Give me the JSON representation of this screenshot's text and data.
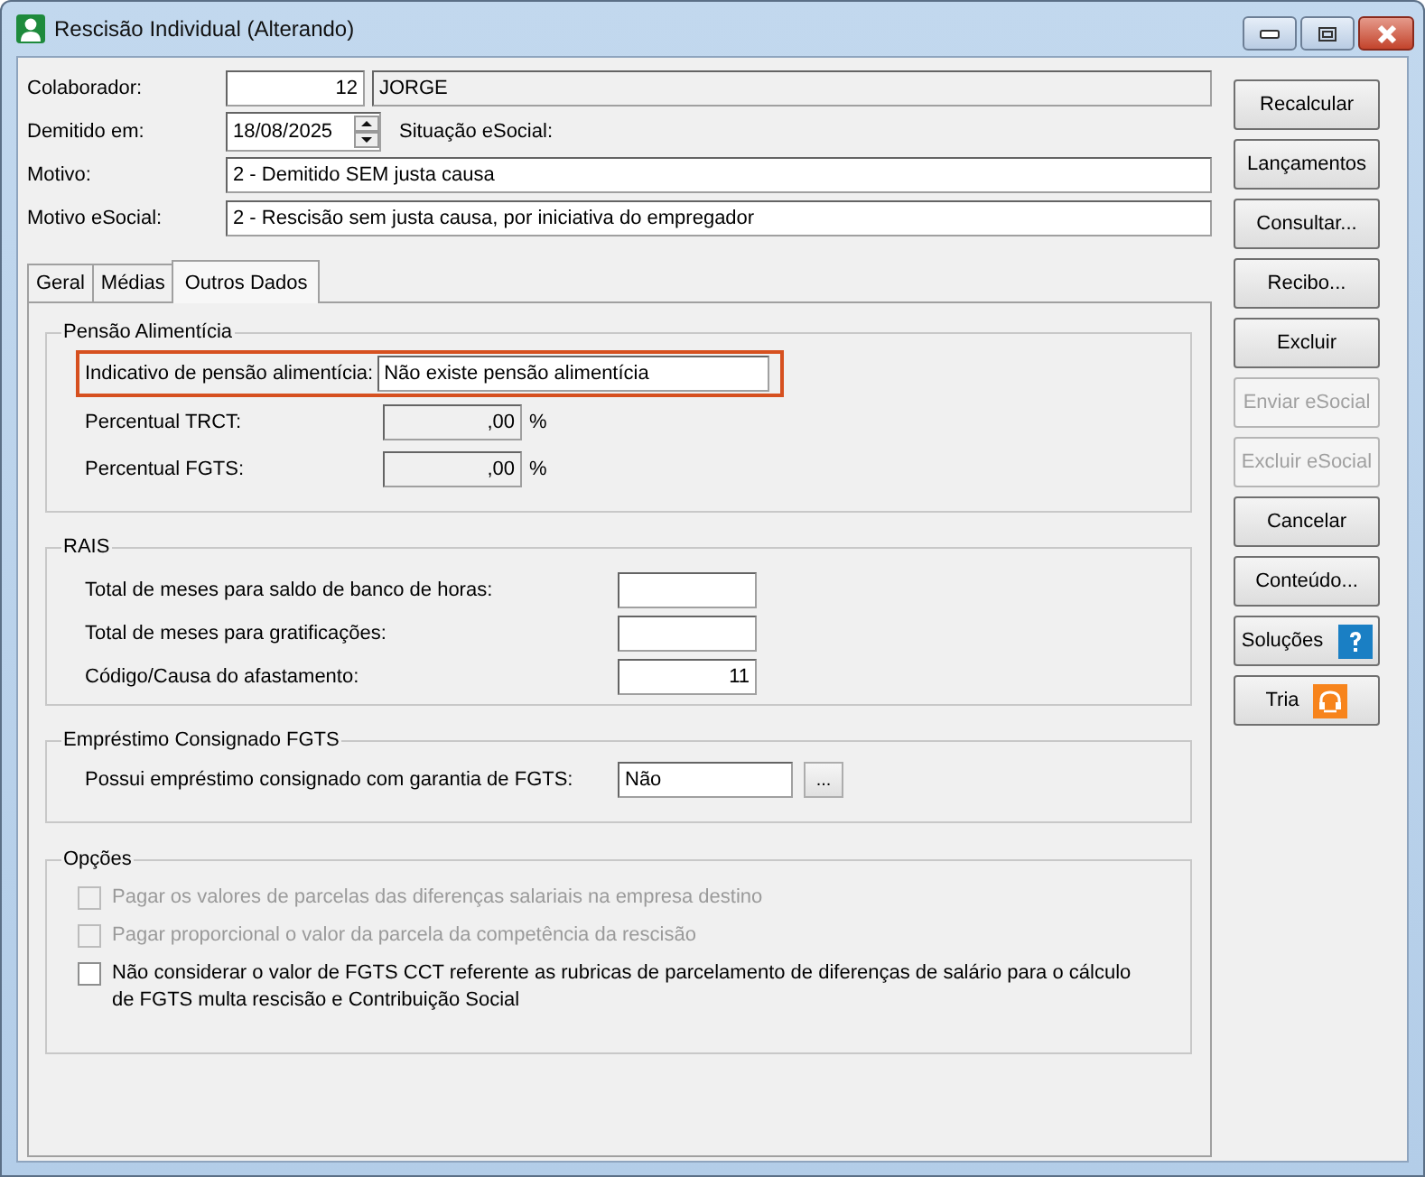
{
  "window": {
    "title": "Rescisão Individual (Alterando)"
  },
  "header": {
    "colaborador_label": "Colaborador:",
    "colaborador_code": "12",
    "colaborador_name": "JORGE",
    "demitido_label": "Demitido em:",
    "demitido_date": "18/08/2025",
    "situacao_label": "Situação eSocial:",
    "motivo_label": "Motivo:",
    "motivo": "2 - Demitido SEM justa causa",
    "motivo_esocial_label": "Motivo eSocial:",
    "motivo_esocial": "2 - Rescisão sem justa causa, por iniciativa do empregador"
  },
  "tabs": [
    {
      "label": "Geral",
      "selected": false
    },
    {
      "label": "Médias",
      "selected": false
    },
    {
      "label": "Outros Dados",
      "selected": true
    }
  ],
  "pensao": {
    "title": "Pensão Alimentícia",
    "indicativo_label": "Indicativo de pensão alimentícia:",
    "indicativo_value": "Não existe pensão alimentícia",
    "highlighted": true,
    "rows": [
      {
        "label": "Percentual TRCT:",
        "value": ",00",
        "unit": "%"
      },
      {
        "label": "Percentual FGTS:",
        "value": ",00",
        "unit": "%"
      }
    ]
  },
  "rais": {
    "title": "RAIS",
    "rows": [
      {
        "label": "Total de meses para saldo de banco de horas:",
        "value": ""
      },
      {
        "label": "Total de meses para gratificações:",
        "value": ""
      },
      {
        "label": "Código/Causa do afastamento:",
        "value": "11"
      }
    ]
  },
  "emprestimo": {
    "title": "Empréstimo Consignado FGTS",
    "label": "Possui empréstimo consignado com garantia de FGTS:",
    "value": "Não",
    "button": "..."
  },
  "opcoes": {
    "title": "Opções",
    "items": [
      {
        "label": "Pagar os valores de parcelas das diferenças salariais na empresa destino",
        "checked": false,
        "disabled": true
      },
      {
        "label": "Pagar proporcional o valor da parcela da competência da rescisão",
        "checked": false,
        "disabled": true
      },
      {
        "label": "Não considerar o valor de FGTS CCT referente as rubricas de parcelamento de diferenças de salário para o cálculo de FGTS multa rescisão e Contribuição Social",
        "checked": false,
        "disabled": false
      }
    ]
  },
  "buttons": [
    {
      "label": "Recalcular",
      "disabled": false,
      "kind": "plain"
    },
    {
      "label": "Lançamentos",
      "disabled": false,
      "kind": "plain"
    },
    {
      "label": "Consultar...",
      "disabled": false,
      "kind": "plain"
    },
    {
      "label": "Recibo...",
      "disabled": false,
      "kind": "plain"
    },
    {
      "label": "Excluir",
      "disabled": false,
      "kind": "plain"
    },
    {
      "label": "Enviar eSocial",
      "disabled": true,
      "kind": "plain"
    },
    {
      "label": "Excluir eSocial",
      "disabled": true,
      "kind": "plain"
    },
    {
      "label": "Cancelar",
      "disabled": false,
      "kind": "plain"
    },
    {
      "label": "Conteúdo...",
      "disabled": false,
      "kind": "plain"
    },
    {
      "label": "Soluções",
      "disabled": false,
      "kind": "help"
    },
    {
      "label": "Tria",
      "disabled": false,
      "kind": "support"
    }
  ]
}
